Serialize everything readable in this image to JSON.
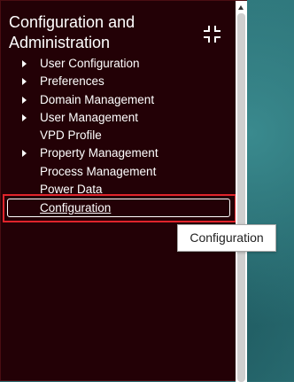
{
  "panel": {
    "title": "Configuration and Administration",
    "collapse_icon": "collapse-arrows-icon"
  },
  "menu": {
    "items": [
      {
        "label": "User Configuration",
        "expandable": true
      },
      {
        "label": "Preferences",
        "expandable": true
      },
      {
        "label": "Domain Management",
        "expandable": true
      },
      {
        "label": "User Management",
        "expandable": true
      },
      {
        "label": "VPD Profile",
        "expandable": false
      },
      {
        "label": "Property Management",
        "expandable": true
      },
      {
        "label": "Process Management",
        "expandable": false
      },
      {
        "label": "Power Data",
        "expandable": false
      },
      {
        "label": "Configuration",
        "expandable": false,
        "selected": true
      }
    ]
  },
  "tooltip": {
    "text": "Configuration"
  },
  "colors": {
    "panel_bg": "#230106",
    "selection_outline": "#e0242b",
    "background": "#2b6f74"
  }
}
